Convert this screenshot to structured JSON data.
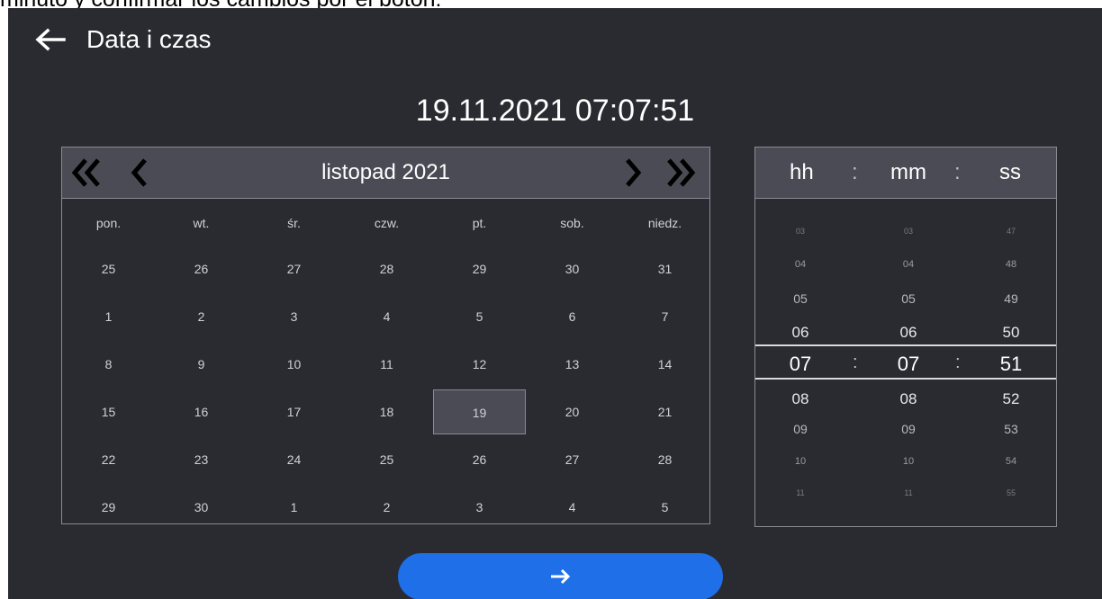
{
  "caption": "minuto y confirmar los cambios por el botón:",
  "header": {
    "title": "Data i czas",
    "datetime": "19.11.2021 07:07:51"
  },
  "calendar": {
    "month_label": "listopad 2021",
    "weekdays": [
      "pon.",
      "wt.",
      "śr.",
      "czw.",
      "pt.",
      "sob.",
      "niedz."
    ],
    "weeks": [
      [
        "25",
        "26",
        "27",
        "28",
        "29",
        "30",
        "31"
      ],
      [
        "1",
        "2",
        "3",
        "4",
        "5",
        "6",
        "7"
      ],
      [
        "8",
        "9",
        "10",
        "11",
        "12",
        "13",
        "14"
      ],
      [
        "15",
        "16",
        "17",
        "18",
        "19",
        "20",
        "21"
      ],
      [
        "22",
        "23",
        "24",
        "25",
        "26",
        "27",
        "28"
      ],
      [
        "29",
        "30",
        "1",
        "2",
        "3",
        "4",
        "5"
      ]
    ],
    "selected_day": "19"
  },
  "time": {
    "headers": [
      "hh",
      ":",
      "mm",
      ":",
      "ss"
    ],
    "hours": [
      "03",
      "04",
      "05",
      "06",
      "07",
      "08",
      "09",
      "10",
      "11"
    ],
    "minutes": [
      "03",
      "04",
      "05",
      "06",
      "07",
      "08",
      "09",
      "10",
      "11"
    ],
    "seconds": [
      "47",
      "48",
      "49",
      "50",
      "51",
      "52",
      "53",
      "54",
      "55"
    ],
    "separator": ":"
  },
  "icons": {
    "back": "arrow-left-icon",
    "first": "double-chevron-left-icon",
    "prev": "chevron-left-icon",
    "next": "chevron-right-icon",
    "last": "double-chevron-right-icon",
    "confirm": "arrow-right-icon"
  },
  "colors": {
    "background": "#2a2a31",
    "panel": "#4b4b55",
    "accent": "#1e6fe8"
  }
}
